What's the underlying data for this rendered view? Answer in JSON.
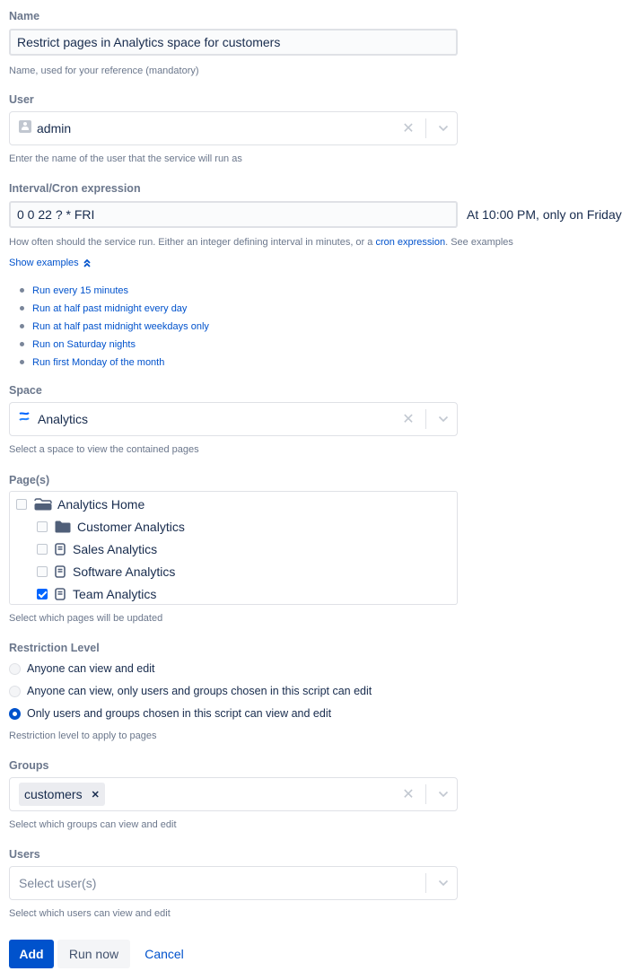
{
  "name": {
    "label": "Name",
    "value": "Restrict pages in Analytics space for customers",
    "help": "Name, used for your reference (mandatory)"
  },
  "user": {
    "label": "User",
    "value": "admin",
    "help": "Enter the name of the user that the service will run as"
  },
  "interval": {
    "label": "Interval/Cron expression",
    "value": "0 0 22 ? * FRI",
    "description": "At 10:00 PM, only on Friday",
    "help_prefix": "How often should the service run. Either an integer defining interval in minutes, or a",
    "help_link": "cron expression",
    "help_suffix": ". See examples",
    "toggle_label": "Show examples",
    "examples": [
      "Run every 15 minutes",
      "Run at half past midnight every day",
      "Run at half past midnight weekdays only",
      "Run on Saturday nights",
      "Run first Monday of the month"
    ]
  },
  "space": {
    "label": "Space",
    "value": "Analytics",
    "help": "Select a space to view the contained pages"
  },
  "pages": {
    "label": "Page(s)",
    "help": "Select which pages will be updated",
    "items": [
      {
        "label": "Analytics Home",
        "icon": "folder-open-icon",
        "checked": false,
        "level": 0
      },
      {
        "label": "Customer Analytics",
        "icon": "folder-icon",
        "checked": false,
        "level": 1
      },
      {
        "label": "Sales Analytics",
        "icon": "page-icon",
        "checked": false,
        "level": 1
      },
      {
        "label": "Software Analytics",
        "icon": "page-icon",
        "checked": false,
        "level": 1
      },
      {
        "label": "Team Analytics",
        "icon": "page-icon",
        "checked": true,
        "level": 1
      }
    ]
  },
  "restriction": {
    "label": "Restriction Level",
    "help": "Restriction level to apply to pages",
    "options": [
      {
        "label": "Anyone can view and edit",
        "selected": false
      },
      {
        "label": "Anyone can view, only users and groups chosen in this script can edit",
        "selected": false
      },
      {
        "label": "Only users and groups chosen in this script can view and edit",
        "selected": true
      }
    ]
  },
  "groups": {
    "label": "Groups",
    "tags": [
      "customers"
    ],
    "help": "Select which groups can view and edit"
  },
  "users": {
    "label": "Users",
    "placeholder": "Select user(s)",
    "help": "Select which users can view and edit"
  },
  "actions": {
    "add": "Add",
    "run_now": "Run now",
    "cancel": "Cancel"
  },
  "colors": {
    "primary": "#0052cc",
    "text": "#172b4d",
    "subtle": "#6b778c",
    "checkbox_checked": "#0065ff"
  }
}
